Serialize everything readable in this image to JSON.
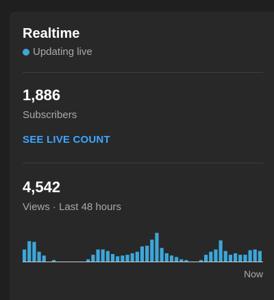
{
  "realtime": {
    "title": "Realtime",
    "status": "Updating live"
  },
  "subscribers": {
    "value": "1,886",
    "label": "Subscribers",
    "live_count_link": "SEE LIVE COUNT"
  },
  "views": {
    "value": "4,542",
    "label": "Views · Last 48 hours",
    "end_label": "Now"
  },
  "colors": {
    "bar": "#3ea6d8",
    "live_dot": "#3ea6d8",
    "link": "#3ea6ff"
  },
  "chart_data": {
    "type": "bar",
    "xlabel": "Now",
    "values": [
      16,
      27,
      26,
      13,
      8,
      0,
      2,
      0,
      0,
      0,
      0,
      0,
      0,
      3,
      9,
      16,
      16,
      14,
      10,
      7,
      8,
      9,
      11,
      13,
      20,
      21,
      29,
      38,
      18,
      11,
      8,
      6,
      3,
      2,
      0,
      0,
      2,
      9,
      13,
      16,
      28,
      14,
      9,
      11,
      9,
      9,
      15,
      16,
      14
    ],
    "ylim": [
      0,
      40
    ]
  }
}
